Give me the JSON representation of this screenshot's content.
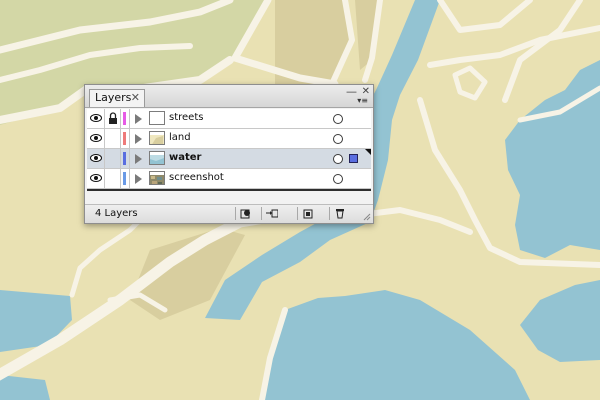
{
  "panel": {
    "tab_label": "Layers",
    "tab_close_glyph": "✕",
    "collapse_glyph": "—",
    "close_glyph": "✕",
    "menu_glyph": "▾≡",
    "layer_count": "4 Layers"
  },
  "layers": [
    {
      "name": "streets",
      "color": "#e65ce6",
      "visible": true,
      "locked": true,
      "selected": false,
      "thumbnail": "blank"
    },
    {
      "name": "land",
      "color": "#ee7a7a",
      "visible": true,
      "locked": false,
      "selected": false,
      "thumbnail": "land"
    },
    {
      "name": "water",
      "color": "#5a6ee0",
      "visible": true,
      "locked": false,
      "selected": true,
      "thumbnail": "water"
    },
    {
      "name": "screenshot",
      "color": "#6a9ae6",
      "visible": true,
      "locked": false,
      "selected": false,
      "thumbnail": "photo"
    }
  ],
  "footer_buttons": [
    {
      "icon": "make-clipping-mask-icon"
    },
    {
      "icon": "new-sublayer-icon"
    },
    {
      "icon": "new-layer-icon"
    },
    {
      "icon": "trash-icon"
    }
  ],
  "colors": {
    "land": "#e9e1b3",
    "green_area": "#d3d7a6",
    "built_area": "#d8ce9f",
    "water": "#93c3d2",
    "street": "#f7f3e6",
    "selection": "#d4dbe3"
  }
}
